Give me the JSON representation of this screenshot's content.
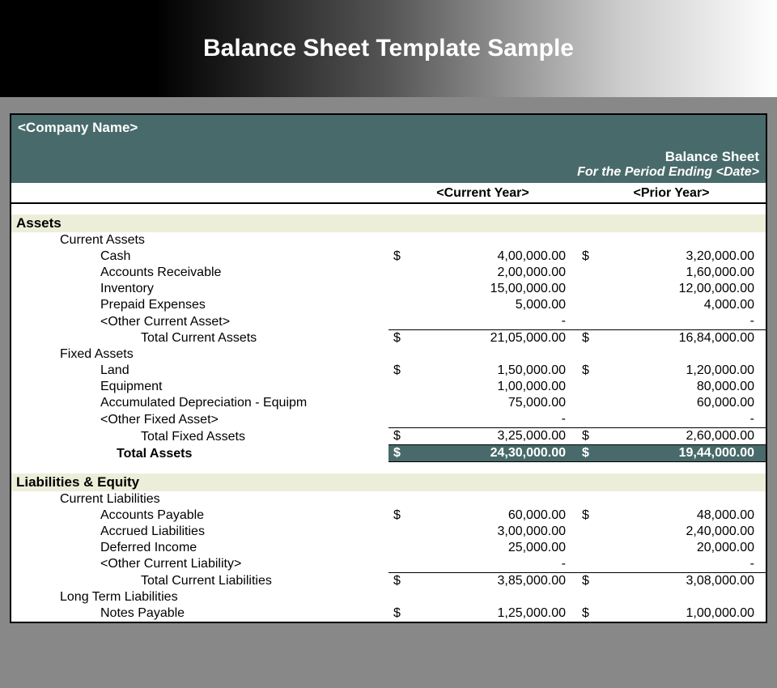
{
  "banner": {
    "title": "Balance Sheet Template Sample"
  },
  "header": {
    "company_name": "<Company Name>",
    "bs_label": "Balance Sheet",
    "period": "For the Period Ending <Date>"
  },
  "columns": {
    "current_year": "<Current Year>",
    "prior_year": "<Prior Year>",
    "currency": "$"
  },
  "sections": {
    "assets": {
      "title": "Assets",
      "current": {
        "title": "Current Assets",
        "items": [
          {
            "label": "Cash",
            "cy": "4,00,000.00",
            "py": "3,20,000.00",
            "show_sym": true
          },
          {
            "label": "Accounts Receivable",
            "cy": "2,00,000.00",
            "py": "1,60,000.00",
            "show_sym": false
          },
          {
            "label": "Inventory",
            "cy": "15,00,000.00",
            "py": "12,00,000.00",
            "show_sym": false
          },
          {
            "label": "Prepaid Expenses",
            "cy": "5,000.00",
            "py": "4,000.00",
            "show_sym": false
          },
          {
            "label": "<Other Current Asset>",
            "cy": "-",
            "py": "-",
            "show_sym": false
          }
        ],
        "total": {
          "label": "Total Current Assets",
          "cy": "21,05,000.00",
          "py": "16,84,000.00"
        }
      },
      "fixed": {
        "title": "Fixed Assets",
        "items": [
          {
            "label": "Land",
            "cy": "1,50,000.00",
            "py": "1,20,000.00",
            "show_sym": true
          },
          {
            "label": "Equipment",
            "cy": "1,00,000.00",
            "py": "80,000.00",
            "show_sym": false
          },
          {
            "label": "Accumulated Depreciation - Equipm",
            "cy": "75,000.00",
            "py": "60,000.00",
            "show_sym": false
          },
          {
            "label": "<Other Fixed Asset>",
            "cy": "-",
            "py": "-",
            "show_sym": false
          }
        ],
        "total": {
          "label": "Total Fixed Assets",
          "cy": "3,25,000.00",
          "py": "2,60,000.00"
        }
      },
      "grand_total": {
        "label": "Total Assets",
        "cy": "24,30,000.00",
        "py": "19,44,000.00"
      }
    },
    "liab_equity": {
      "title": "Liabilities & Equity",
      "current": {
        "title": "Current Liabilities",
        "items": [
          {
            "label": "Accounts Payable",
            "cy": "60,000.00",
            "py": "48,000.00",
            "show_sym": true
          },
          {
            "label": "Accrued Liabilities",
            "cy": "3,00,000.00",
            "py": "2,40,000.00",
            "show_sym": false
          },
          {
            "label": "Deferred Income",
            "cy": "25,000.00",
            "py": "20,000.00",
            "show_sym": false
          },
          {
            "label": "<Other Current Liability>",
            "cy": "-",
            "py": "-",
            "show_sym": false
          }
        ],
        "total": {
          "label": "Total Current Liabilities",
          "cy": "3,85,000.00",
          "py": "3,08,000.00"
        }
      },
      "longterm": {
        "title": "Long Term Liabilities",
        "items": [
          {
            "label": "Notes Payable",
            "cy": "1,25,000.00",
            "py": "1,00,000.00",
            "show_sym": true
          }
        ]
      }
    }
  }
}
